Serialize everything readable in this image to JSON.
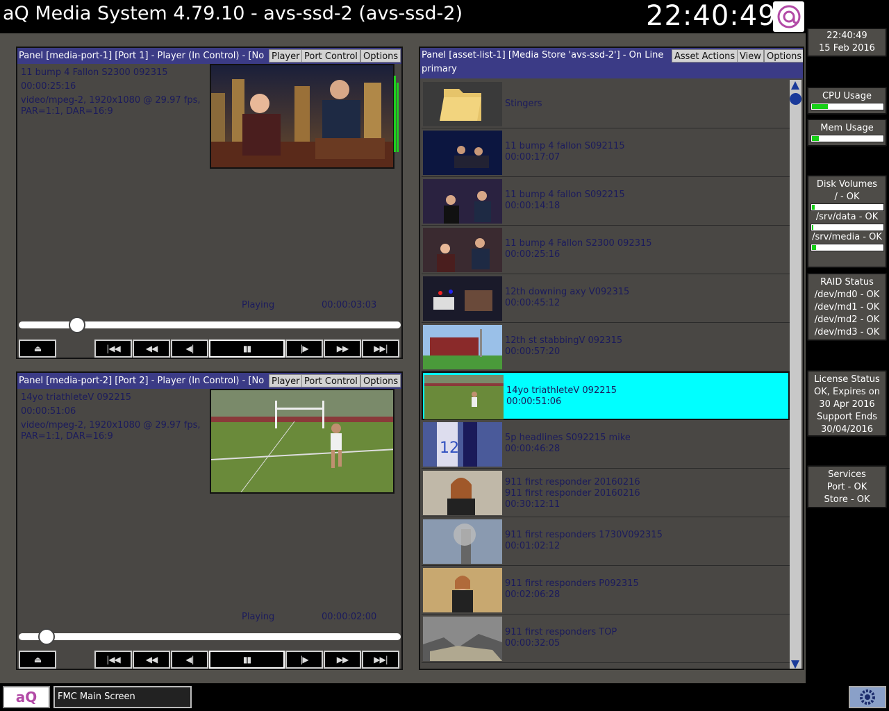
{
  "app": {
    "title": "aQ Media System 4.79.10 - avs-ssd-2 (avs-ssd-2)",
    "clock": "22:40:49"
  },
  "player1": {
    "header": "Panel [media-port-1] [Port 1] - Player (In Control) - [No",
    "btn_player": "Player",
    "btn_port_control": "Port Control",
    "btn_options": "Options",
    "clip_name": "11 bump 4 Fallon S2300 092315",
    "duration": "00:00:25:16",
    "format": "video/mpeg-2, 1920x1080 @ 29.97 fps, PAR=1:1, DAR=16:9",
    "state": "Playing",
    "position": "00:00:03:03",
    "progress": 0.13
  },
  "player2": {
    "header": "Panel [media-port-2] [Port 2] - Player (In Control) - [No",
    "btn_player": "Player",
    "btn_port_control": "Port Control",
    "btn_options": "Options",
    "clip_name": "14yo triathleteV 092215",
    "duration": "00:00:51:06",
    "format": "video/mpeg-2, 1920x1080 @ 29.97 fps, PAR=1:1, DAR=16:9",
    "state": "Playing",
    "position": "00:00:02:00",
    "progress": 0.05
  },
  "transport": {
    "eject": "⏏",
    "go_start": "|◀◀",
    "rewind": "◀◀",
    "step_back": "◀|",
    "pause": "▮▮",
    "step_fwd": "|▶",
    "fast_fwd": "▶▶",
    "go_end": "▶▶|"
  },
  "asset_list": {
    "header": "Panel [asset-list-1] [Media Store 'avs-ssd-2'] - On Line",
    "subheader": "primary",
    "btn_asset_actions": "Asset Actions",
    "btn_view": "View",
    "btn_options": "Options",
    "items": [
      {
        "name": "Stingers",
        "line2": "",
        "line3": ""
      },
      {
        "name": "11 bump 4 fallon S092115",
        "line2": "00:00:17:07",
        "line3": ""
      },
      {
        "name": "11 bump 4 fallon S092215",
        "line2": "00:00:14:18",
        "line3": ""
      },
      {
        "name": "11 bump 4 Fallon S2300 092315",
        "line2": "00:00:25:16",
        "line3": ""
      },
      {
        "name": "12th downing axy V092315",
        "line2": "00:00:45:12",
        "line3": ""
      },
      {
        "name": "12th st stabbingV 092315",
        "line2": "00:00:57:20",
        "line3": ""
      },
      {
        "name": "14yo triathleteV 092215",
        "line2": "00:00:51:06",
        "line3": ""
      },
      {
        "name": "5p headlines S092215 mike",
        "line2": "00:00:46:28",
        "line3": ""
      },
      {
        "name": "911 first responder 20160216",
        "line2": "911 first responder 20160216",
        "line3": "00:30:12:11"
      },
      {
        "name": "911 first responders 1730V092315",
        "line2": "00:01:02:12",
        "line3": ""
      },
      {
        "name": "911 first responders P092315",
        "line2": "00:02:06:28",
        "line3": ""
      },
      {
        "name": "911 first responders TOP",
        "line2": "00:00:32:05",
        "line3": ""
      }
    ]
  },
  "sidebar": {
    "date_time": "22:40:49",
    "date": "15 Feb 2016",
    "cpu_label": "CPU Usage",
    "cpu_level": 0.22,
    "mem_label": "Mem Usage",
    "mem_level": 0.1,
    "disk_label": "Disk Volumes",
    "disks": [
      {
        "label": "/ - OK",
        "level": 0.04
      },
      {
        "label": "/srv/data - OK",
        "level": 0.01
      },
      {
        "label": "/srv/media - OK",
        "level": 0.06
      }
    ],
    "raid_label": "RAID Status",
    "raid": [
      "/dev/md0 - OK",
      "/dev/md1 - OK",
      "/dev/md2 - OK",
      "/dev/md3 - OK"
    ],
    "license_label": "License Status",
    "license_lines": [
      "OK, Expires on",
      "30 Apr 2016",
      "Support Ends",
      "30/04/2016"
    ],
    "services_label": "Services",
    "services_lines": [
      "Port - OK",
      "Store - OK"
    ]
  },
  "bottom": {
    "logo_text": "aQ",
    "main_screen": "FMC Main Screen"
  },
  "colors": {
    "header_blue": "#3b3b86",
    "panel_bg": "#494744",
    "selected_row": "#00ffff",
    "meter_green": "#17d017"
  }
}
